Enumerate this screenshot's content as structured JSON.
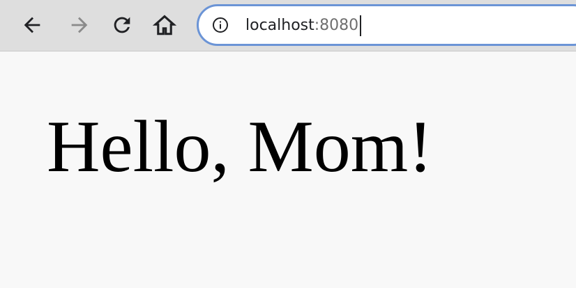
{
  "browser": {
    "toolbar": {
      "buttons": [
        {
          "icon": "back-arrow-icon",
          "enabled": true
        },
        {
          "icon": "forward-arrow-icon",
          "enabled": false
        },
        {
          "icon": "reload-icon",
          "enabled": true
        },
        {
          "icon": "home-icon",
          "enabled": true
        }
      ]
    },
    "address_bar": {
      "info_icon": "info-icon",
      "host": "localhost",
      "port": ":8080",
      "focused": true
    },
    "colors": {
      "toolbar_bg": "#dedede",
      "omnibox_border": "#6b94d6",
      "page_bg": "#f8f8f8"
    }
  },
  "page": {
    "heading": "Hello, Mom!"
  }
}
